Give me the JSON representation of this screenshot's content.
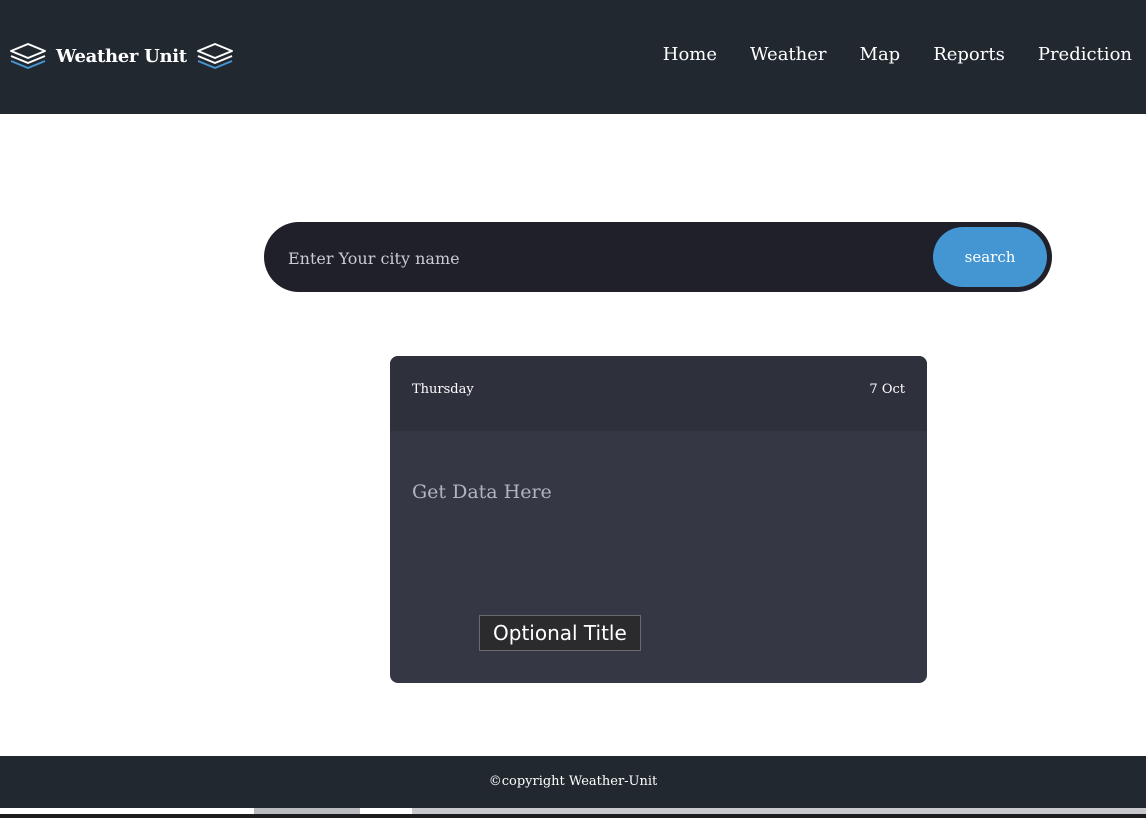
{
  "navbar": {
    "brand": "Weather Unit",
    "brand_icon_left": "layers-icon",
    "brand_icon_right": "layers-icon",
    "accent_color": "#4496d2",
    "links": [
      "Home",
      "Weather",
      "Map",
      "Reports",
      "Prediction"
    ]
  },
  "search": {
    "placeholder": "Enter Your city name",
    "value": "",
    "button_label": "search"
  },
  "card": {
    "day": "Thursday",
    "date": "7 Oct",
    "body_text": "Get Data Here",
    "tooltip": "Optional Title"
  },
  "footer": {
    "text": "©copyright Weather-Unit"
  }
}
